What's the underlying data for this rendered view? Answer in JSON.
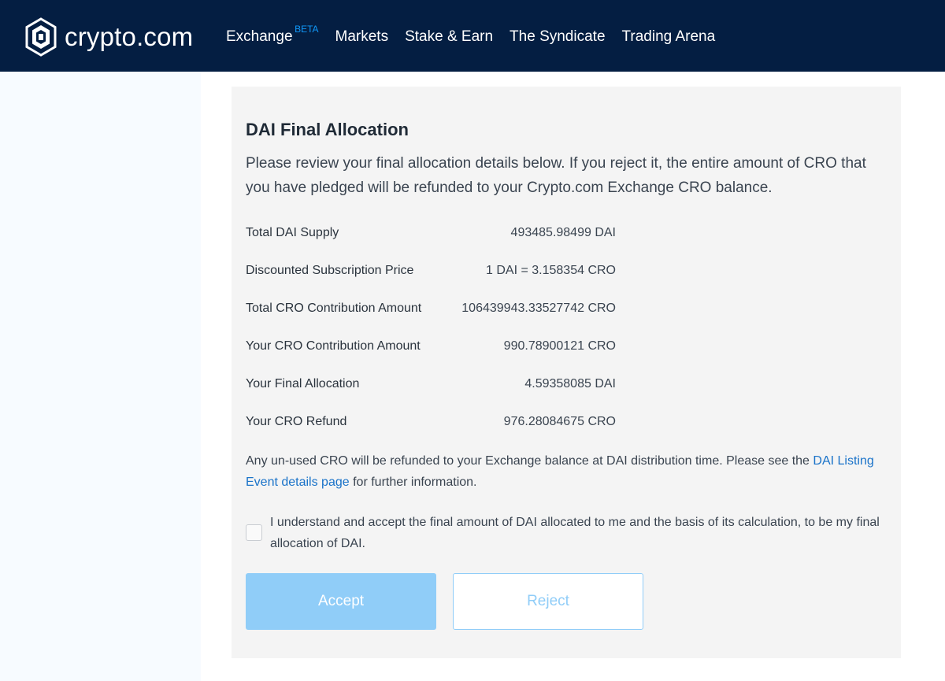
{
  "header": {
    "logo_text": "crypto.com",
    "nav": [
      {
        "label": "Exchange",
        "badge": "BETA"
      },
      {
        "label": "Markets"
      },
      {
        "label": "Stake & Earn"
      },
      {
        "label": "The Syndicate"
      },
      {
        "label": "Trading Arena"
      }
    ]
  },
  "card": {
    "title": "DAI Final Allocation",
    "description": "Please review your final allocation details below. If you reject it, the entire amount of CRO that you have pledged will be refunded to your Crypto.com Exchange CRO balance.",
    "details": [
      {
        "label": "Total DAI Supply",
        "value": "493485.98499 DAI"
      },
      {
        "label": "Discounted Subscription Price",
        "value": "1 DAI = 3.158354 CRO"
      },
      {
        "label": "Total CRO Contribution Amount",
        "value": "106439943.33527742 CRO"
      },
      {
        "label": "Your CRO Contribution Amount",
        "value": "990.78900121 CRO"
      },
      {
        "label": "Your Final Allocation",
        "value": "4.59358085 DAI"
      },
      {
        "label": "Your CRO Refund",
        "value": "976.28084675 CRO"
      }
    ],
    "note_before": "Any un-used CRO will be refunded to your Exchange balance at DAI distribution time. Please see the ",
    "note_link": "DAI Listing Event details page",
    "note_after": " for further information.",
    "checkbox_label": "I understand and accept the final amount of DAI allocated to me and the basis of its calculation, to be my final allocation of DAI.",
    "accept_label": "Accept",
    "reject_label": "Reject"
  }
}
